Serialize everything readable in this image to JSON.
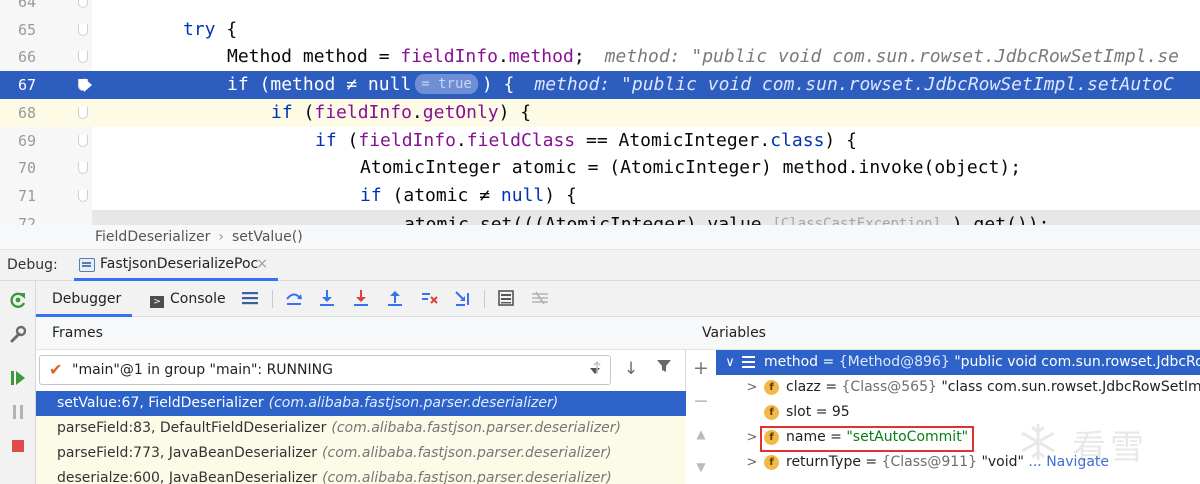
{
  "editor": {
    "lines": [
      {
        "num": "64",
        "segments": [],
        "style": "normal"
      },
      {
        "num": "65",
        "segments": [
          {
            "t": "try",
            "c": "kw"
          },
          {
            "t": " {",
            "c": ""
          }
        ],
        "style": "normal"
      },
      {
        "num": "66",
        "segments": [
          {
            "t": "Method method = ",
            "c": ""
          },
          {
            "t": "fieldInfo",
            "c": "fld"
          },
          {
            "t": ".",
            "c": ""
          },
          {
            "t": "method",
            "c": "fld"
          },
          {
            "t": ";",
            "c": ""
          },
          {
            "t": "method: \"public void com.sun.rowset.JdbcRowSetImpl.se",
            "c": "hint"
          }
        ],
        "style": "normal"
      },
      {
        "num": "67",
        "segments": [
          {
            "t": "if",
            "c": "kw"
          },
          {
            "t": " (method ≠ ",
            "c": ""
          },
          {
            "t": "null",
            "c": "kw"
          },
          {
            "t": "= true",
            "c": "pill"
          },
          {
            "t": ") {",
            "c": ""
          },
          {
            "t": "method: \"public void com.sun.rowset.JdbcRowSetImpl.setAutoC",
            "c": "hint"
          }
        ],
        "style": "exec"
      },
      {
        "num": "68",
        "segments": [
          {
            "t": "if",
            "c": "kw"
          },
          {
            "t": " (",
            "c": ""
          },
          {
            "t": "fieldInfo",
            "c": "fld"
          },
          {
            "t": ".",
            "c": ""
          },
          {
            "t": "getOnly",
            "c": "fld"
          },
          {
            "t": ") {",
            "c": ""
          }
        ],
        "style": "current"
      },
      {
        "num": "69",
        "segments": [
          {
            "t": "if",
            "c": "kw"
          },
          {
            "t": " (",
            "c": ""
          },
          {
            "t": "fieldInfo",
            "c": "fld"
          },
          {
            "t": ".",
            "c": ""
          },
          {
            "t": "fieldClass",
            "c": "fld"
          },
          {
            "t": " == AtomicInteger.",
            "c": ""
          },
          {
            "t": "class",
            "c": "kw"
          },
          {
            "t": ") {",
            "c": ""
          }
        ],
        "style": "normal"
      },
      {
        "num": "70",
        "segments": [
          {
            "t": "AtomicInteger atomic = (AtomicInteger) method.invoke(object);",
            "c": ""
          }
        ],
        "style": "normal"
      },
      {
        "num": "71",
        "segments": [
          {
            "t": "if",
            "c": "kw"
          },
          {
            "t": " (atomic ≠ ",
            "c": ""
          },
          {
            "t": "null",
            "c": "kw"
          },
          {
            "t": ") {",
            "c": ""
          }
        ],
        "style": "normal"
      },
      {
        "num": "72",
        "segments": [
          {
            "t": "atomic.set(((AtomicInteger) value ",
            "c": ""
          },
          {
            "t": "[ClassCastException]",
            "c": "pill-red"
          },
          {
            "t": " ).get());",
            "c": ""
          }
        ],
        "style": "gray"
      }
    ]
  },
  "breadcrumb": {
    "items": [
      "FieldDeserializer",
      "setValue()"
    ]
  },
  "debug": {
    "label": "Debug:",
    "session_tab": "FastjsonDeserializePoc",
    "close_glyph": "×"
  },
  "toolbar": {
    "debugger_tab": "Debugger",
    "console_tab": "Console"
  },
  "frames": {
    "title": "Frames",
    "thread": "\"main\"@1 in group \"main\": RUNNING",
    "items": [
      {
        "method": "setValue:67, FieldDeserializer",
        "pkg": "(com.alibaba.fastjson.parser.deserializer)"
      },
      {
        "method": "parseField:83, DefaultFieldDeserializer",
        "pkg": "(com.alibaba.fastjson.parser.deserializer)"
      },
      {
        "method": "parseField:773, JavaBeanDeserializer",
        "pkg": "(com.alibaba.fastjson.parser.deserializer)"
      },
      {
        "method": "deserialze:600, JavaBeanDeserializer",
        "pkg": "(com.alibaba.fastjson.parser.deserializer)"
      }
    ]
  },
  "variables": {
    "title": "Variables",
    "rows": [
      {
        "name": "method",
        "ref": "{Method@896}",
        "value": "\"public void com.sun.rowset.JdbcRowSe",
        "link": ""
      },
      {
        "name": "clazz",
        "ref": "{Class@565}",
        "value": "\"class com.sun.rowset.JdbcRowSetImpl\"",
        "link": "... Navigate"
      },
      {
        "name": "slot",
        "ref": "",
        "value": "95",
        "link": ""
      },
      {
        "name": "name",
        "ref": "",
        "value": "\"setAutoCommit\"",
        "link": ""
      },
      {
        "name": "returnType",
        "ref": "{Class@911}",
        "value": "\"void\"",
        "link": "... Navigate"
      }
    ]
  },
  "watermark": {
    "text": "看雪"
  },
  "colors": {
    "accent": "#3574f0",
    "selection": "#2d63c9",
    "exec_line": "#2d5dbf",
    "keyword": "#0033b3",
    "field": "#871094",
    "string": "#067d17"
  }
}
